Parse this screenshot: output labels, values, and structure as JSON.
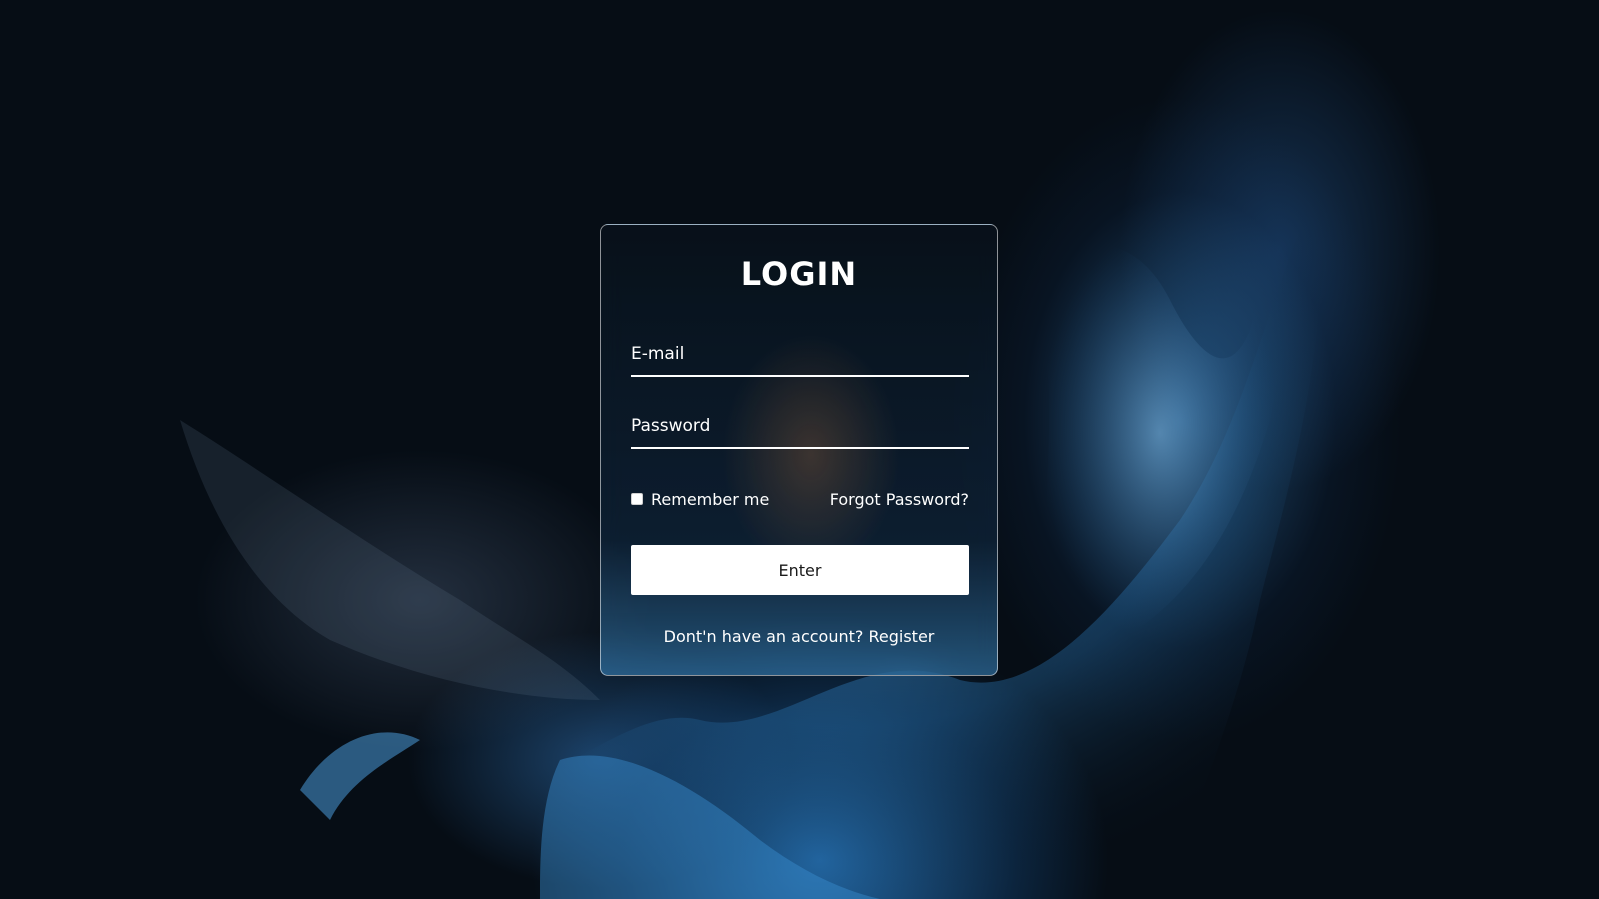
{
  "login": {
    "title": "LOGIN",
    "email_placeholder": "E-mail",
    "password_placeholder": "Password",
    "remember_label": "Remember me",
    "forgot_label": "Forgot Password?",
    "enter_label": "Enter",
    "no_account_text": "Dont'n have an account?",
    "register_label": "Register"
  },
  "colors": {
    "background": "#060d15",
    "accent": "#2f86c8",
    "text": "#ffffff"
  }
}
